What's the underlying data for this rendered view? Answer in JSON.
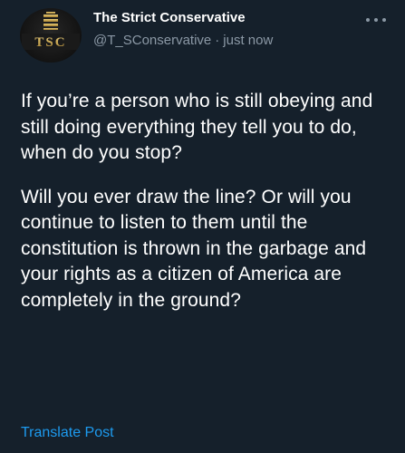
{
  "author": {
    "display_name": "The Strict Conservative",
    "handle": "@T_SConservative",
    "separator": "·",
    "timestamp": "just now",
    "avatar_text": "TSC"
  },
  "tweet": {
    "paragraphs": [
      "If you’re a person who is still obeying and still doing everything they tell you to do, when do you stop?",
      "Will you ever draw the line? Or will you continue to listen to them until the constitution is thrown in the garbage and your rights as a citizen of America are completely in the ground?"
    ]
  },
  "actions": {
    "translate_label": "Translate Post",
    "more_icon": "more-horizontal-icon"
  },
  "colors": {
    "background": "#15202b",
    "text": "#ffffff",
    "secondary_text": "#8b98a5",
    "link": "#1d9bf0",
    "avatar_gold": "#c9a54a"
  }
}
